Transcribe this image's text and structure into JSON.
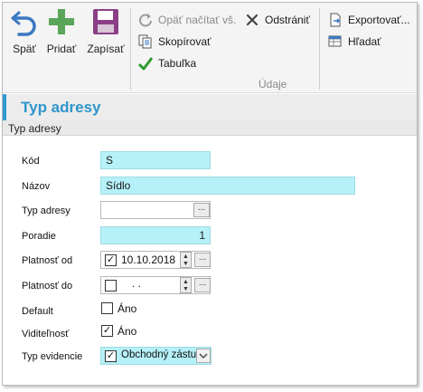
{
  "toolbar": {
    "back_label": "Späť",
    "add_label": "Pridať",
    "save_label": "Zapísať",
    "reload_label": "Opäť načítať vš.",
    "delete_label": "Odstrániť",
    "copy_label": "Skopírovať",
    "table_label": "Tabuľka",
    "export_label": "Exportovať...",
    "find_label": "Hľadať",
    "group_label": "Údaje"
  },
  "header": {
    "title": "Typ adresy",
    "section": "Typ adresy"
  },
  "form": {
    "kod": {
      "label": "Kód",
      "value": "S"
    },
    "nazov": {
      "label": "Názov",
      "value": "Sídlo"
    },
    "typ_adresy": {
      "label": "Typ adresy",
      "value": "",
      "button": "..."
    },
    "poradie": {
      "label": "Poradie",
      "value": "1"
    },
    "platnost_od": {
      "label": "Platnosť od",
      "value": "10.10.2018",
      "checked": true,
      "button": "..."
    },
    "platnost_do": {
      "label": "Platnosť do",
      "value": " .   .",
      "checked": false,
      "button": "..."
    },
    "default": {
      "label": "Default",
      "option": "Áno",
      "checked": false
    },
    "viditelnost": {
      "label": "Viditeľnosť",
      "option": "Áno",
      "checked": true
    },
    "typ_evidencie": {
      "label": "Typ evidencie",
      "value": "Obchodný zástu",
      "checked": true
    }
  },
  "icons": {
    "back": "undo-arrow-icon",
    "add": "plus-icon",
    "save": "floppy-disk-icon",
    "reload": "refresh-icon",
    "delete": "x-icon",
    "copy": "copy-icon",
    "table": "checkmark-icon",
    "export": "export-document-icon",
    "find": "find-table-icon"
  },
  "colors": {
    "accent": "#2f95cc",
    "field_bg": "#b6f0f8",
    "add_green": "#5aa55a",
    "save_purple": "#8b3f86"
  }
}
